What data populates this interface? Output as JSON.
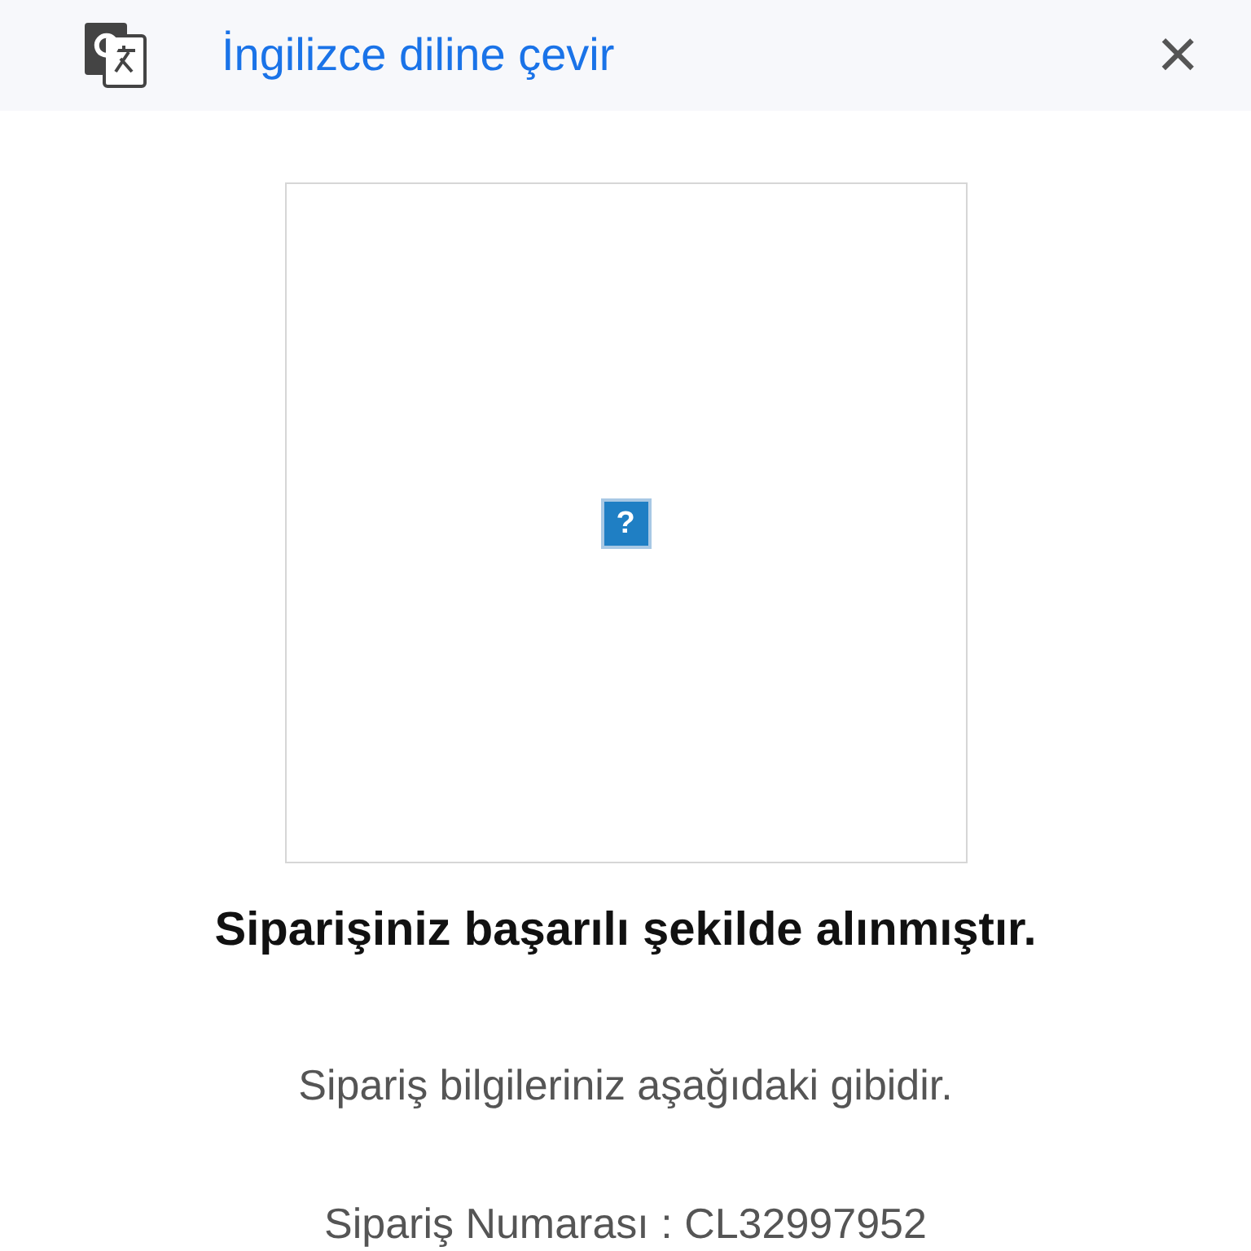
{
  "translate_bar": {
    "label": "İngilizce diline çevir",
    "close": "×"
  },
  "image": {
    "broken_icon": "?"
  },
  "heading": "Siparişiniz başarılı şekilde alınmıştır.",
  "info": "Sipariş bilgileriniz aşağıdaki gibidir.",
  "order_number": "Sipariş Numarası : CL32997952"
}
